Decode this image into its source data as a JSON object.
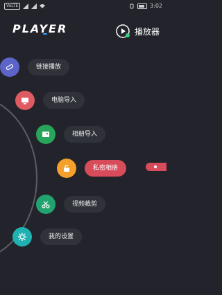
{
  "status": {
    "time": "3:02",
    "left_chip": "VoLTE"
  },
  "header": {
    "brand": "PLAYER",
    "player_label": "播放器"
  },
  "menu": [
    {
      "label": "链接播放",
      "color": "#5d64c7"
    },
    {
      "label": "电脑导入",
      "color": "#e05a64"
    },
    {
      "label": "相册导入",
      "color": "#27a55a"
    },
    {
      "label": "私密相册",
      "color": "#f4a02b"
    },
    {
      "label": "视频裁剪",
      "color": "#21a26f"
    },
    {
      "label": "我的设置",
      "color": "#1fb0b0"
    }
  ]
}
